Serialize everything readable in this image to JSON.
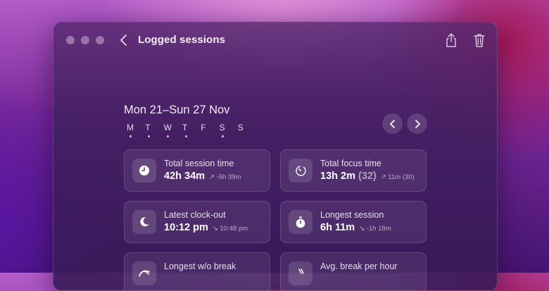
{
  "toolbar": {
    "title": "Logged sessions"
  },
  "week": {
    "range": "Mon 21–Sun 27 Nov",
    "days": [
      {
        "letter": "M",
        "logged": true
      },
      {
        "letter": "T",
        "logged": true
      },
      {
        "letter": "W",
        "logged": true
      },
      {
        "letter": "T",
        "logged": true
      },
      {
        "letter": "F",
        "logged": false
      },
      {
        "letter": "S",
        "logged": true
      },
      {
        "letter": "S",
        "logged": false
      }
    ]
  },
  "stats": [
    {
      "label": "Total session time",
      "value": "42h 34m",
      "extra": "",
      "arrow": "↗",
      "delta": "-5h 39m"
    },
    {
      "label": "Total focus time",
      "value": "13h 2m",
      "extra": "(32)",
      "arrow": "↗",
      "delta": "11m (30)"
    },
    {
      "label": "Latest clock-out",
      "value": "10:12 pm",
      "extra": "",
      "arrow": "↘",
      "delta": "10:48 pm"
    },
    {
      "label": "Longest session",
      "value": "6h 11m",
      "extra": "",
      "arrow": "↘",
      "delta": "-1h 18m"
    },
    {
      "label": "Longest w/o break",
      "value": "",
      "extra": "",
      "arrow": "",
      "delta": ""
    },
    {
      "label": "Avg. break per hour",
      "value": "",
      "extra": "",
      "arrow": "",
      "delta": ""
    }
  ]
}
